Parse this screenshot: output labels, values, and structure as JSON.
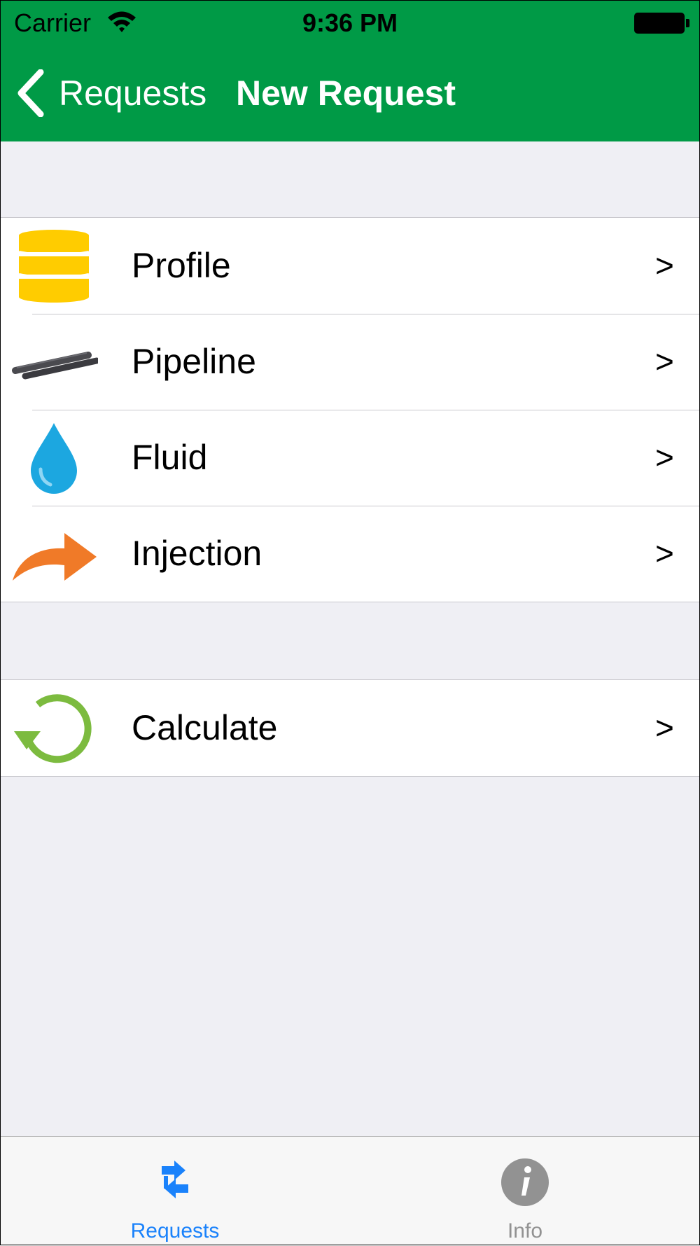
{
  "status": {
    "carrier": "Carrier",
    "time": "9:36 PM"
  },
  "nav": {
    "back_label": "Requests",
    "title": "New Request"
  },
  "sections": [
    {
      "rows": [
        {
          "label": "Profile",
          "icon": "database-icon",
          "color": "#ffcc00"
        },
        {
          "label": "Pipeline",
          "icon": "pipes-icon",
          "color": "#4a4a4f"
        },
        {
          "label": "Fluid",
          "icon": "water-drop-icon",
          "color": "#1ca7e0"
        },
        {
          "label": "Injection",
          "icon": "curved-arrow-icon",
          "color": "#f07a28"
        }
      ]
    },
    {
      "rows": [
        {
          "label": "Calculate",
          "icon": "refresh-icon",
          "color": "#7cbb3f"
        }
      ]
    }
  ],
  "chevron": ">",
  "tabbar": {
    "tabs": [
      {
        "label": "Requests",
        "selected": true,
        "color": "#1a82fb",
        "icon": "swap-arrows-icon"
      },
      {
        "label": "Info",
        "selected": false,
        "color": "#929292",
        "icon": "info-icon"
      }
    ]
  },
  "colors": {
    "header": "#009a46",
    "background": "#efeff4"
  }
}
